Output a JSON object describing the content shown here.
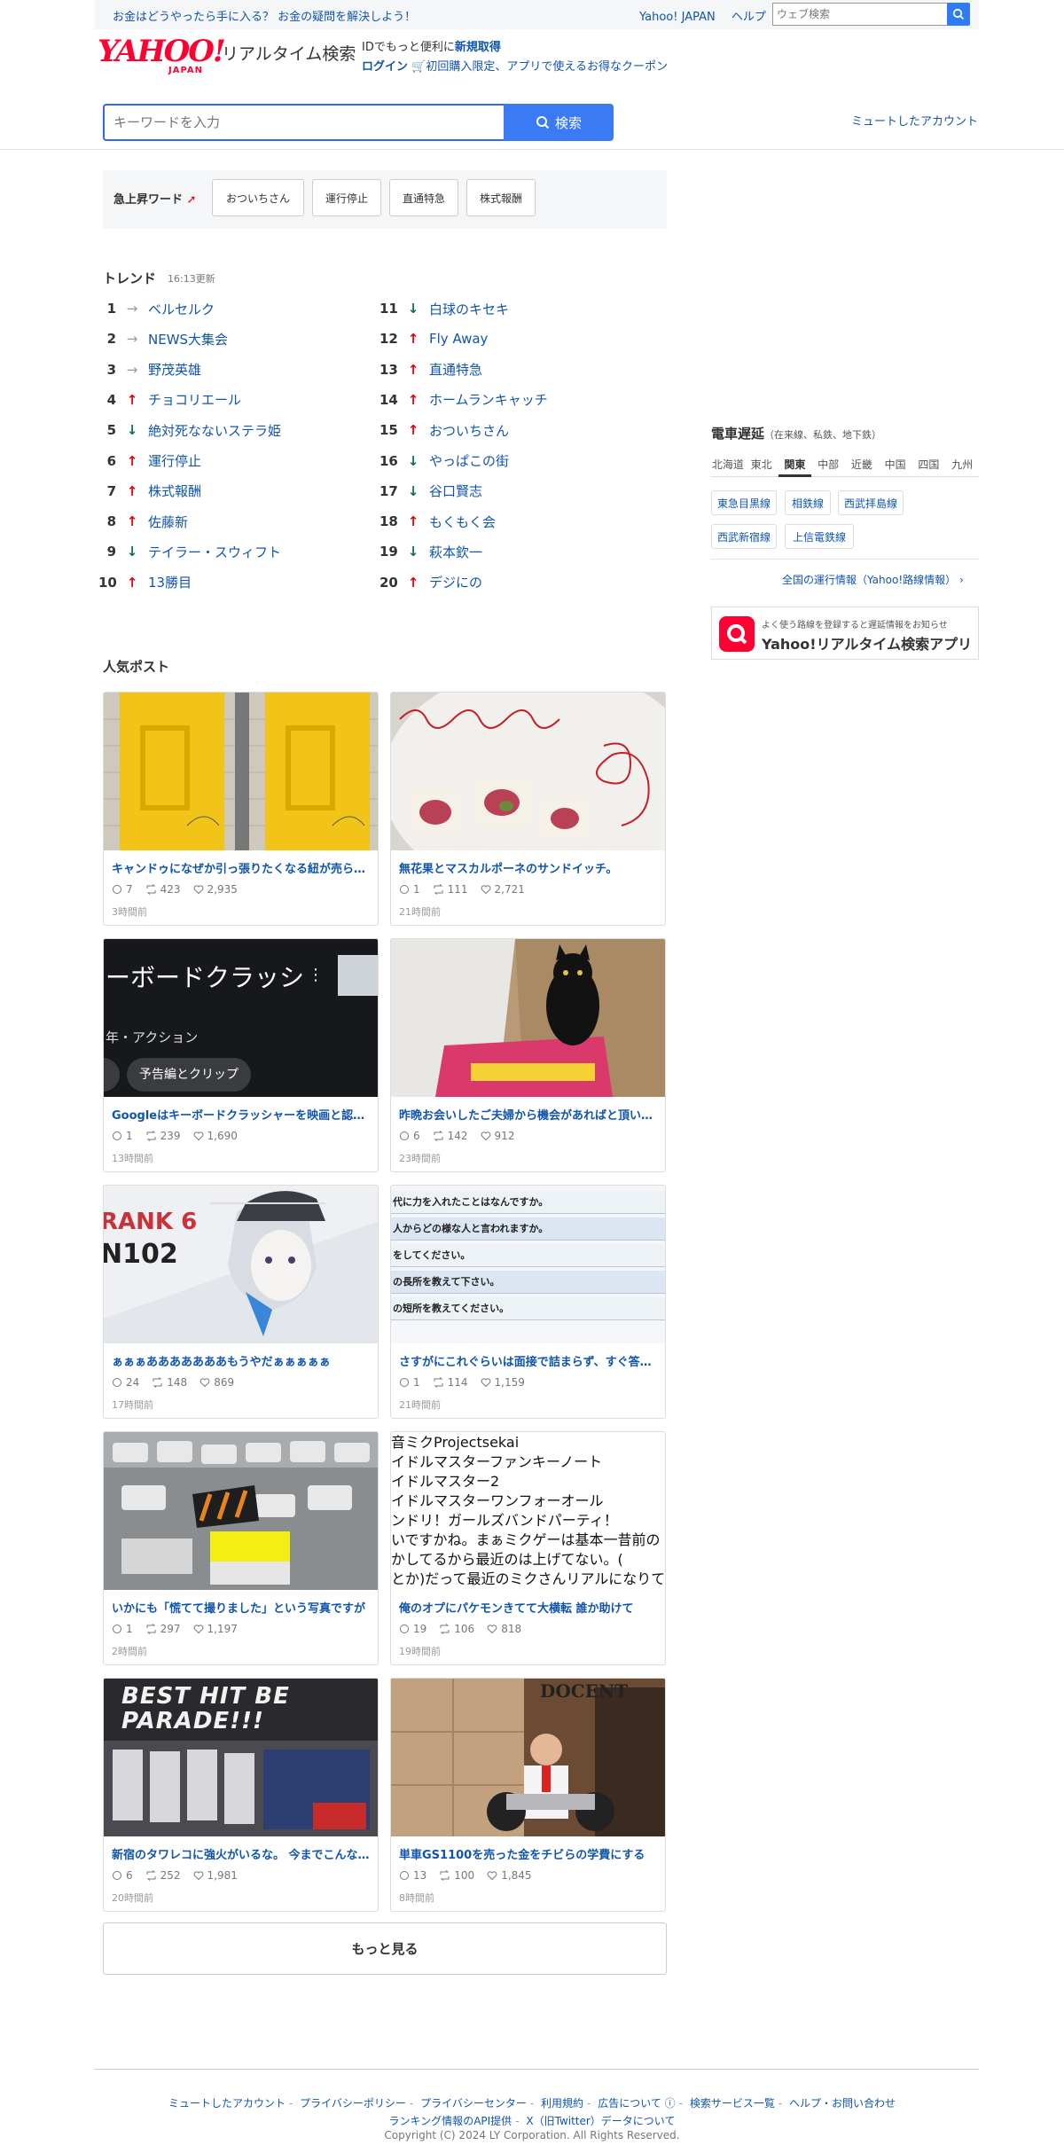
{
  "topbar": {
    "promo": "お金はどうやったら手に入る？ お金の疑問を解決しよう！",
    "links": [
      "Yahoo! JAPAN",
      "ヘルプ"
    ],
    "web_search_placeholder": "ウェブ検索"
  },
  "header": {
    "logo_text": "YAHOO!",
    "logo_sub": "JAPAN",
    "service_name": "リアルタイム検索",
    "id_prefix": "IDでもっと便利に",
    "signup": "新規取得",
    "login": "ログイン",
    "coupon": "初回購入限定、アプリで使えるお得なクーポン",
    "muted_accounts": "ミュートしたアカウント"
  },
  "search": {
    "placeholder": "キーワードを入力",
    "button": "検索"
  },
  "rising": {
    "label": "急上昇ワード",
    "words": [
      "おついちさん",
      "運行停止",
      "直通特急",
      "株式報酬"
    ]
  },
  "trend": {
    "title": "トレンド",
    "updated": "16:13更新",
    "items": [
      {
        "rank": "1",
        "dir": "flat",
        "word": "ベルセルク"
      },
      {
        "rank": "2",
        "dir": "flat",
        "word": "NEWS大集会"
      },
      {
        "rank": "3",
        "dir": "flat",
        "word": "野茂英雄"
      },
      {
        "rank": "4",
        "dir": "up",
        "word": "チョコリエール"
      },
      {
        "rank": "5",
        "dir": "down",
        "word": "絶対死なないステラ姫"
      },
      {
        "rank": "6",
        "dir": "up",
        "word": "運行停止"
      },
      {
        "rank": "7",
        "dir": "up",
        "word": "株式報酬"
      },
      {
        "rank": "8",
        "dir": "up",
        "word": "佐藤新"
      },
      {
        "rank": "9",
        "dir": "down",
        "word": "テイラー・スウィフト"
      },
      {
        "rank": "10",
        "dir": "up",
        "word": "13勝目"
      },
      {
        "rank": "11",
        "dir": "down",
        "word": "白球のキセキ"
      },
      {
        "rank": "12",
        "dir": "up",
        "word": "Fly Away"
      },
      {
        "rank": "13",
        "dir": "up",
        "word": "直通特急"
      },
      {
        "rank": "14",
        "dir": "up",
        "word": "ホームランキャッチ"
      },
      {
        "rank": "15",
        "dir": "up",
        "word": "おついちさん"
      },
      {
        "rank": "16",
        "dir": "down",
        "word": "やっぱこの街"
      },
      {
        "rank": "17",
        "dir": "down",
        "word": "谷口賢志"
      },
      {
        "rank": "18",
        "dir": "up",
        "word": "もくもく会"
      },
      {
        "rank": "19",
        "dir": "down",
        "word": "萩本欽一"
      },
      {
        "rank": "20",
        "dir": "up",
        "word": "デジにの"
      }
    ]
  },
  "popular": {
    "title": "人気ポスト",
    "posts": [
      {
        "title": "キャンドゥになぜか引っ張りたくなる紐が売られていた",
        "replies": "7",
        "reposts": "423",
        "likes": "2,935",
        "time": "3時間前"
      },
      {
        "title": "無花果とマスカルポーネのサンドイッチ。",
        "replies": "1",
        "reposts": "111",
        "likes": "2,721",
        "time": "21時間前"
      },
      {
        "title": "Googleはキーボードクラッシャーを映画と認識している",
        "replies": "1",
        "reposts": "239",
        "likes": "1,690",
        "time": "13時間前"
      },
      {
        "title": "昨晩お会いしたご夫婦から機会があればと頂いたもの",
        "replies": "6",
        "reposts": "142",
        "likes": "912",
        "time": "23時間前"
      },
      {
        "title": "ぁぁぁあああああああもうやだぁぁぁぁぁ",
        "replies": "24",
        "reposts": "148",
        "likes": "869",
        "time": "17時間前"
      },
      {
        "title": "さすがにこれぐらいは面接で詰まらず、すぐ答えたい",
        "replies": "1",
        "reposts": "114",
        "likes": "1,159",
        "time": "21時間前"
      },
      {
        "title": "いかにも「慌てて撮りました」という写真ですが",
        "replies": "1",
        "reposts": "297",
        "likes": "1,197",
        "time": "2時間前"
      },
      {
        "title": "俺のオプにパケモンきてて大横転 誰か助けて",
        "replies": "19",
        "reposts": "106",
        "likes": "818",
        "time": "19時間前"
      },
      {
        "title": "新宿のタワレコに強火がいるな。 今までこんなの見たことない",
        "replies": "6",
        "reposts": "252",
        "likes": "1,981",
        "time": "20時間前"
      },
      {
        "title": "単車GS1100を売った金をチビらの学費にする",
        "replies": "13",
        "reposts": "100",
        "likes": "1,845",
        "time": "8時間前"
      }
    ],
    "img_texts": {
      "kb_title": "ーボードクラッシ",
      "kb_genre": "年・アクション",
      "kb_button": "予告編とクリップ",
      "rank_label": "RANK 6",
      "rank_code": "N102",
      "interview_lines": [
        "代に力を入れたことはなんですか。",
        "人からどの様な人と言われますか。",
        "をしてください。",
        "の長所を教えて下さい。",
        "の短所を教えてください。"
      ],
      "miku_lines": [
        "音ミクProjectsekai",
        "イドルマスターファンキーノート",
        "イドルマスター2",
        "イドルマスターワンフォーオール",
        "ンドリ！ガールズバンドパーティ！",
        "いですかね。まぁミクゲーは基本一昔前の",
        "かしてるから最近のは上げてない。(",
        "とか)だって最近のミクさんリアルになりて"
      ],
      "tower_text": "BEST HIT BE PARADE!!!",
      "shop_sign": "DOCENT"
    },
    "more": "もっと見る"
  },
  "train": {
    "title": "電車遅延",
    "subtitle": "（在来線、私鉄、地下鉄）",
    "regions": [
      "北海道",
      "東北",
      "関東",
      "中部",
      "近畿",
      "中国",
      "四国",
      "九州"
    ],
    "active_region": "関東",
    "lines": [
      "東急目黒線",
      "相鉄線",
      "西武拝島線",
      "西武新宿線",
      "上信電鉄線"
    ],
    "all_link": "全国の運行情報（Yahoo!路線情報）",
    "app_small": "よく使う路線を登録すると遅延情報をお知らせ",
    "app_big": "Yahoo!リアルタイム検索アプリ"
  },
  "footer": {
    "links_row1": [
      "ミュートしたアカウント",
      "プライバシーポリシー",
      "プライバシーセンター",
      "利用規約",
      "広告について",
      "検索サービス一覧",
      "ヘルプ・お問い合わせ"
    ],
    "links_row2": [
      "ランキング情報のAPI提供",
      "X（旧Twitter）データについて"
    ],
    "copyright": "Copyright (C) 2024 LY Corporation. All Rights Reserved."
  },
  "colors": {
    "link": "#1155aa",
    "search_blue": "#3a7bf5",
    "brand_red": "#ff0033",
    "up": "#e60012",
    "down": "#0b6e5b"
  }
}
